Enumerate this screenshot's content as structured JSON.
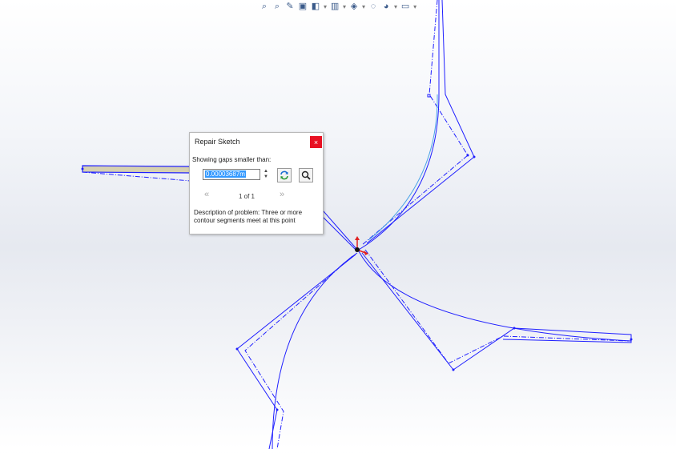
{
  "dialog": {
    "title": "Repair Sketch",
    "close_glyph": "×",
    "gap_label": "Showing gaps smaller than:",
    "gap_value": "0.00003687m",
    "spin_up": "▲",
    "spin_down": "▼",
    "prev_glyph": "«",
    "next_glyph": "»",
    "page": "1 of 1",
    "description": "Description of problem:  Three or more contour segments meet at this point",
    "icons": [
      "refresh-icon",
      "magnifier-icon",
      "close-icon"
    ]
  },
  "toolbar": {
    "icons": [
      "zoom-to-fit-icon",
      "zoom-to-area-icon",
      "previous-view-icon",
      "section-view-icon",
      "view-orientation-icon",
      "display-style-icon",
      "hide-show-icon",
      "edit-appearance-icon",
      "apply-scene-icon",
      "view-settings-icon"
    ],
    "glyphs": [
      "⌕",
      "⌕",
      "✎",
      "▣",
      "◧",
      "▥",
      "◈",
      "◌",
      "◕",
      "▭"
    ],
    "dropdown_glyph": "▾"
  },
  "colors": {
    "sketch_line": "#1f1fff",
    "light_line": "#4aa3e8",
    "selected_fill": "#d6d0b0",
    "close_button": "#e81123",
    "selection_highlight": "#3399ff"
  }
}
